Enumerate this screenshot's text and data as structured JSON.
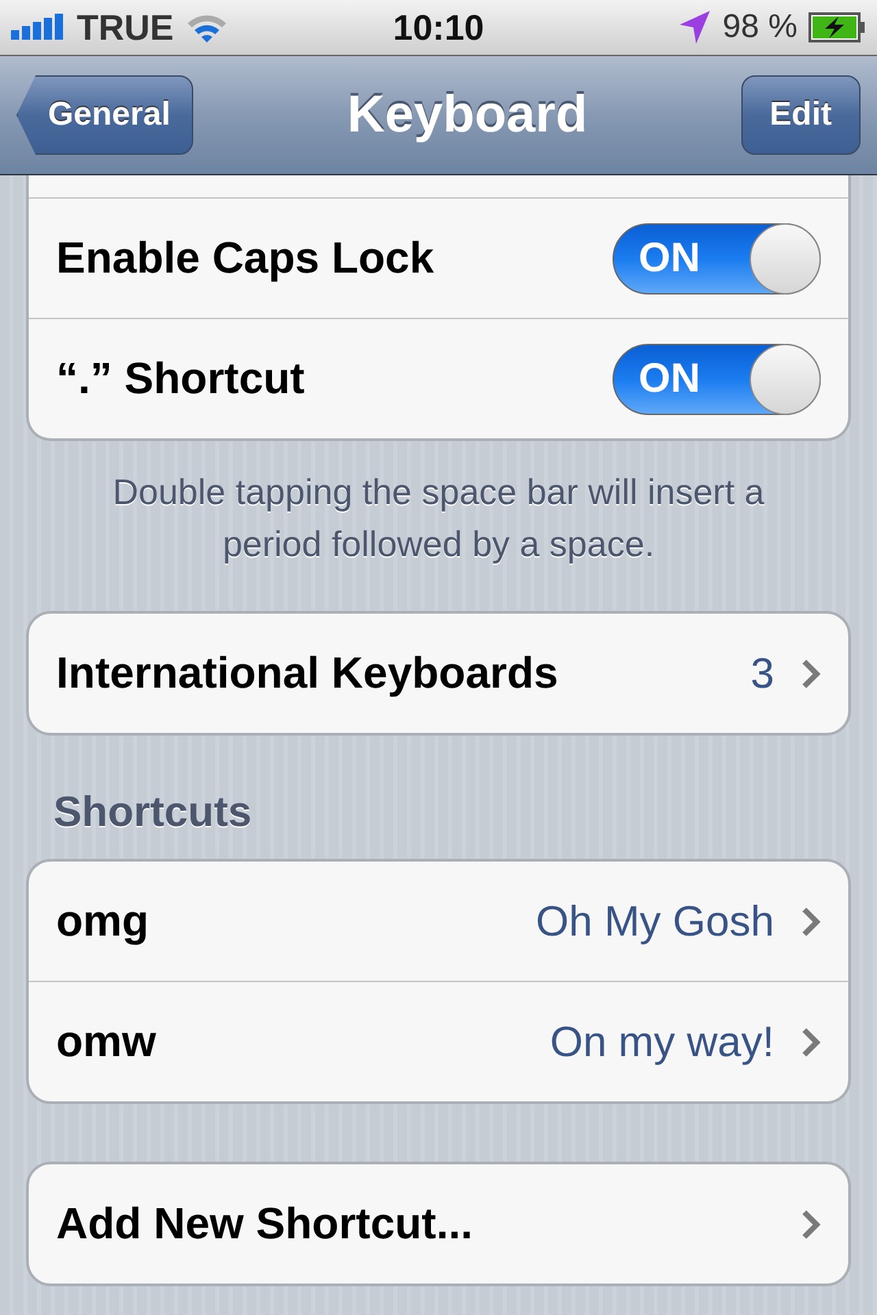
{
  "status_bar": {
    "carrier": "TRUE",
    "time": "10:10",
    "battery": "98 %"
  },
  "nav_bar": {
    "back": "General",
    "title": "Keyboard",
    "action": "Edit"
  },
  "toggles": [
    {
      "label": "Enable Caps Lock",
      "switch_text": "ON",
      "on": true
    },
    {
      "label": "“.” Shortcut",
      "switch_text": "ON",
      "on": true
    }
  ],
  "toggles_footer": "Double tapping the space bar will insert a period followed by a space.",
  "international": {
    "label": "International Keyboards",
    "value": "3"
  },
  "shortcuts": {
    "header": "Shortcuts",
    "rows": [
      {
        "label": "omg",
        "value": "Oh My Gosh"
      },
      {
        "label": "omw",
        "value": "On my way!"
      }
    ]
  },
  "add_button": "Add New Shortcut..."
}
